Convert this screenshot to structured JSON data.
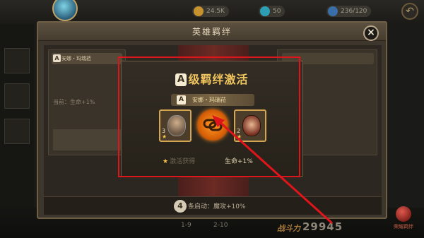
{
  "hud": {
    "resources": [
      {
        "value": "24.5K",
        "color": "#c6922e"
      },
      {
        "value": "50",
        "color": "#2d9fb5"
      },
      {
        "value": "236/120",
        "color": "#3a6ea8"
      }
    ],
    "back_icon": "back-arrow-icon",
    "bottom_items": [
      "1-9",
      "2-10"
    ],
    "power_label": "战斗力",
    "power_value": "29945",
    "fab_label": "荣耀羁绊"
  },
  "panel": {
    "title": "英雄羁绊",
    "close_icon": "close-icon",
    "left_tag": "安娜・玛瑞菈",
    "left_lines": [
      "当前：生命+1%"
    ],
    "bottom_num": "4",
    "bottom_text": "条启动：魔攻+10%"
  },
  "popup": {
    "badge": "A",
    "title": "级羁绊激活",
    "sub_badge": "A",
    "sub_title": "安娜・玛瑞菈",
    "hero_left": {
      "level": "3",
      "name": "hero-portrait-warrior"
    },
    "hero_right": {
      "level": "2",
      "name": "hero-portrait-anna"
    },
    "chain_icon": "chain-link-icon",
    "stat_left": "激活获得",
    "stat_right": "生命+1%"
  },
  "colors": {
    "accent_gold": "#f2c65e",
    "annotation_red": "#e0151b",
    "chain_orange": "#ff9a24"
  }
}
